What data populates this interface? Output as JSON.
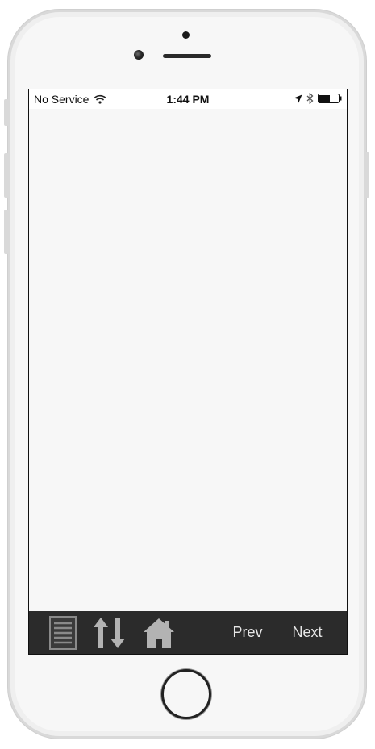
{
  "status_bar": {
    "carrier": "No Service",
    "time": "1:44 PM"
  },
  "toolbar": {
    "prev_label": "Prev",
    "next_label": "Next",
    "icons": [
      "list-icon",
      "sort-arrows-icon",
      "home-icon"
    ]
  },
  "colors": {
    "toolbar_bg": "#2b2b2b",
    "screen_bg": "#f7f7f7",
    "toolbar_text": "#e6e6e6"
  }
}
